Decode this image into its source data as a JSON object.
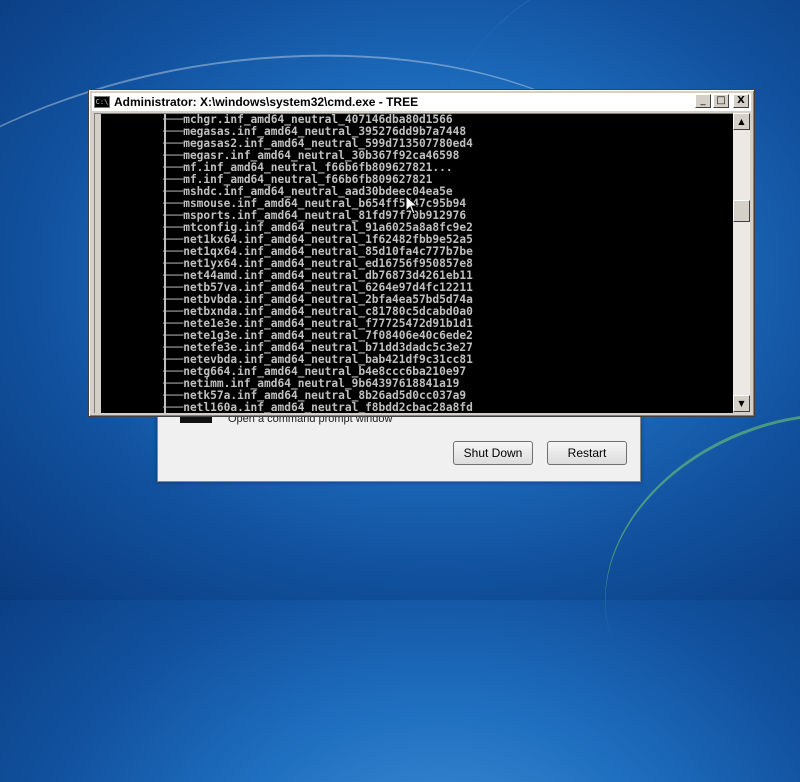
{
  "cmd_window": {
    "title": "Administrator: X:\\windows\\system32\\cmd.exe - TREE",
    "minimize": "_",
    "maximize": "□",
    "close": "X",
    "icon_text": "C:\\",
    "lines": [
      "mchgr.inf_amd64_neutral_407146dba80d1566",
      "megasas.inf_amd64_neutral_395276dd9b7a7448",
      "megasas2.inf_amd64_neutral_599d713507780ed4",
      "megasr.inf_amd64_neutral_30b367f92ca46598",
      "mf.inf_amd64_neutral_f66b6fb809627821...",
      "mf.inf_amd64_neutral_f66b6fb809627821",
      "mshdc.inf_amd64_neutral_aad30bdeec04ea5e",
      "msmouse.inf_amd64_neutral_b654ff5547c95b94",
      "msports.inf_amd64_neutral_81fd97f70b912976",
      "mtconfig.inf_amd64_neutral_91a6025a8a8fc9e2",
      "net1kx64.inf_amd64_neutral_1f62482fbb9e52a5",
      "net1qx64.inf_amd64_neutral_85d10fa4c777b7be",
      "net1yx64.inf_amd64_neutral_ed16756f950857e8",
      "net44amd.inf_amd64_neutral_db76873d4261eb11",
      "netb57va.inf_amd64_neutral_6264e97d4fc12211",
      "netbvbda.inf_amd64_neutral_2bfa4ea57bd5d74a",
      "netbxnda.inf_amd64_neutral_c81780c5dcabd0a0",
      "nete1e3e.inf_amd64_neutral_f77725472d91b1d1",
      "nete1g3e.inf_amd64_neutral_7f08406e40c6ede2",
      "netefe3e.inf_amd64_neutral_b71dd3dadc5c3e27",
      "netevbda.inf_amd64_neutral_bab421df9c31cc81",
      "netg664.inf_amd64_neutral_b4e8ccc6ba210e97",
      "netimm.inf_amd64_neutral_9b64397618841a19",
      "netk57a.inf_amd64_neutral_8b26ad5d0cc037a9",
      "netl160a.inf_amd64_neutral_f8bdd2cbac28a8fd"
    ]
  },
  "recovery": {
    "cmd_label": "Open a command prompt window",
    "shutdown_label": "Shut Down",
    "restart_label": "Restart"
  }
}
